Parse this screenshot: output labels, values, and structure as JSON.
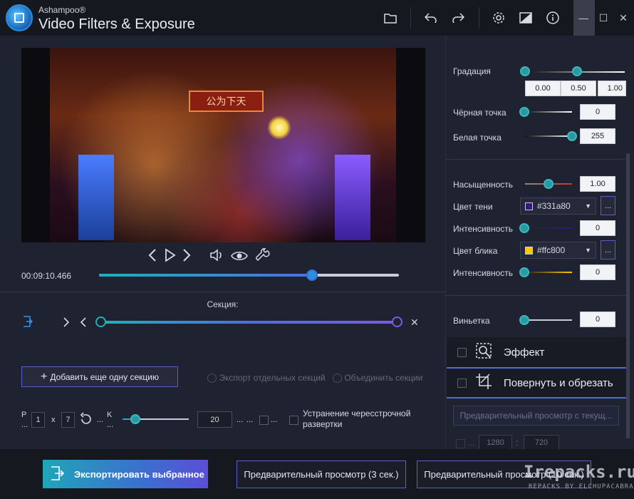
{
  "app": {
    "brand": "Ashampoo®",
    "product": "Video Filters & Exposure"
  },
  "toolbar": {
    "icons": [
      "folder-icon",
      "undo-icon",
      "redo-icon",
      "gear-icon",
      "compare-icon",
      "info-icon"
    ],
    "window_buttons": [
      "minimize-icon",
      "maximize-icon",
      "close-icon"
    ]
  },
  "video": {
    "sign_text": "公为下天",
    "timecode": "00:09:10.466",
    "progress": 0.71
  },
  "section": {
    "label": "Секция:"
  },
  "actions": {
    "add_section": "Добавить еще одну секцию",
    "export_separate": "Экспорт отдельных секций",
    "merge_sections": "Объединить секции"
  },
  "settings": {
    "p_label": "P\n...",
    "val1": "1",
    "x_label": "x",
    "val2": "7",
    "dots1": "...",
    "k_label": "K\n...",
    "num": "20",
    "dots2": "...",
    "dots3": "...",
    "deinterlace": "Устранение чересстрочной развертки"
  },
  "right": {
    "gradation": {
      "label": "Градация",
      "v1": "0.00",
      "v2": "0.50",
      "v3": "1.00"
    },
    "black_point": {
      "label": "Чёрная точка",
      "value": "0"
    },
    "white_point": {
      "label": "Белая точка",
      "value": "255"
    },
    "saturation": {
      "label": "Насыщенность",
      "value": "1.00"
    },
    "shadow_color": {
      "label": "Цвет тени",
      "value": "#331a80",
      "swatch": "#331a80",
      "btn": "..."
    },
    "intensity1": {
      "label": "Интенсивность",
      "value": "0"
    },
    "highlight_color": {
      "label": "Цвет блика",
      "value": "#ffc800",
      "swatch": "#ffc800",
      "btn": "..."
    },
    "intensity2": {
      "label": "Интенсивность",
      "value": "0"
    },
    "vignette": {
      "label": "Виньетка",
      "value": "0"
    },
    "effect": "Эффект",
    "rotate_crop": "Повернуть и обрезать",
    "preview_current": "Предварительный просмотр с текущ...",
    "width": "1280",
    "colon": ":",
    "height": "720"
  },
  "bottom": {
    "export": "Экспортировать выбранное",
    "preview3": "Предварительный просмотр (3 сек.)",
    "preview10": "Предварительный просмотр (10 сек.)",
    "watermark": "Irepacks.ru",
    "watermark_sub": "REPACKS BY ELCHUPACABRA"
  }
}
